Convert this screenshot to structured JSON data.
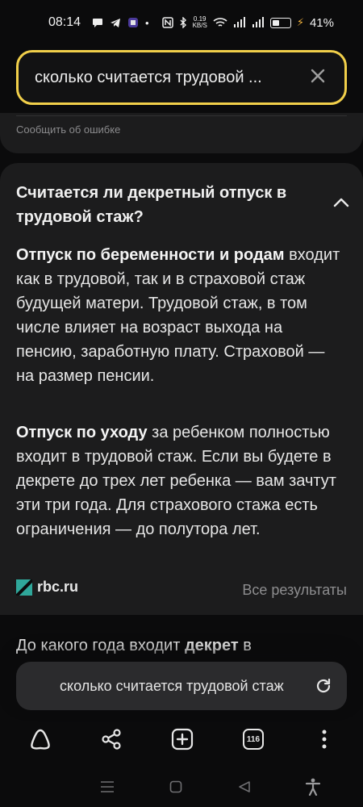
{
  "status_bar": {
    "time": "08:14",
    "speed_value": "0.19",
    "speed_unit": "KB/S",
    "battery_percent": "41%",
    "battery_level": 0.41
  },
  "search": {
    "query": "сколько считается трудовой ...",
    "clear_icon": "close-icon"
  },
  "report": {
    "label": "Сообщить об ошибке"
  },
  "answer": {
    "question": "Считается ли декретный отпуск в трудовой стаж?",
    "p1_bold": "Отпуск по беременности и родам",
    "p1_text": " входит как в трудовой, так и в страховой стаж будущей матери. Трудовой стаж, в том числе влияет на возраст выхода на пенсию, заработную плату. Страховой — на размер пенсии.",
    "p2_bold": "Отпуск по уходу",
    "p2_text": " за ребенком полностью входит в трудовой стаж. Если вы будете в декрете до трех лет ребенка — вам зачтут эти три года. Для страхового стажа есть ограничения — до полутора лет.",
    "source": "rbc.ru",
    "all_results": "Все результаты"
  },
  "next_snippet": {
    "text_before": "До какого года входит ",
    "bold": "декрет",
    "text_after": " в"
  },
  "bottom_search": {
    "query": "сколько считается трудовой стаж"
  },
  "toolbar": {
    "tab_count": "116"
  },
  "colors": {
    "accent_border": "#f1cf4a",
    "card_bg": "#1c1c1d",
    "page_bg": "#0b0b0c",
    "rbc_logo": "#2fa79a"
  }
}
